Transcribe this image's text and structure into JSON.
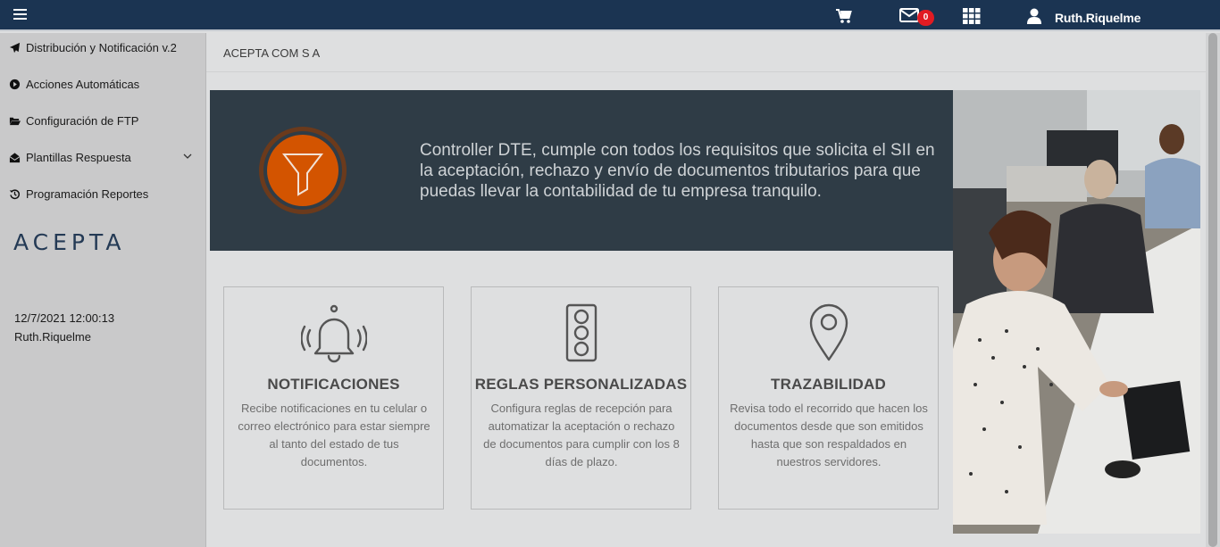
{
  "topbar": {
    "menu_icon": "hamburger-icon",
    "cart_icon": "cart-icon",
    "mail_icon": "envelope-icon",
    "mail_badge": "0",
    "apps_icon": "grid-icon",
    "user_icon": "user-icon",
    "user_name": "Ruth.Riquelme",
    "bar_color": "#1b3452",
    "badge_color": "#e11b22"
  },
  "sidebar": {
    "items": [
      {
        "label": "Distribución y Notificación v.2",
        "icon": "paper-plane-icon"
      },
      {
        "label": "Acciones Automáticas",
        "icon": "play-circle-icon"
      },
      {
        "label": "Configuración de FTP",
        "icon": "folder-open-icon"
      },
      {
        "label": "Plantillas Respuesta",
        "icon": "envelope-open-icon",
        "has_dropdown": true
      },
      {
        "label": "Programación Reportes",
        "icon": "history-icon"
      }
    ],
    "logo": "ACEPTA",
    "datetime": "12/7/2021 12:00:13",
    "user": "Ruth.Riquelme"
  },
  "main": {
    "company": "ACEPTA COM S A",
    "banner": {
      "text": "Controller DTE, cumple con todos los requisitos que solicita el SII en la aceptación, rechazo y envío de documentos tributarios para que puedas llevar la contabilidad de tu empresa tranquilo.",
      "icon": "funnel-icon",
      "accent": "#d35400"
    },
    "cards": [
      {
        "icon": "bell-icon",
        "title": "NOTIFICACIONES",
        "text": "Recibe notificaciones en tu celular o correo electrónico para estar siempre al tanto del estado de tus documentos."
      },
      {
        "icon": "traffic-light-icon",
        "title": "REGLAS PERSONALIZADAS",
        "text": "Configura reglas de recepción para automatizar la aceptación o rechazo de documentos para cumplir con los 8 días de plazo."
      },
      {
        "icon": "map-pin-icon",
        "title": "TRAZABILIDAD",
        "text": "Revisa todo el recorrido que hacen los documentos desde que son emitidos hasta que son respaldados en nuestros servidores."
      }
    ]
  }
}
